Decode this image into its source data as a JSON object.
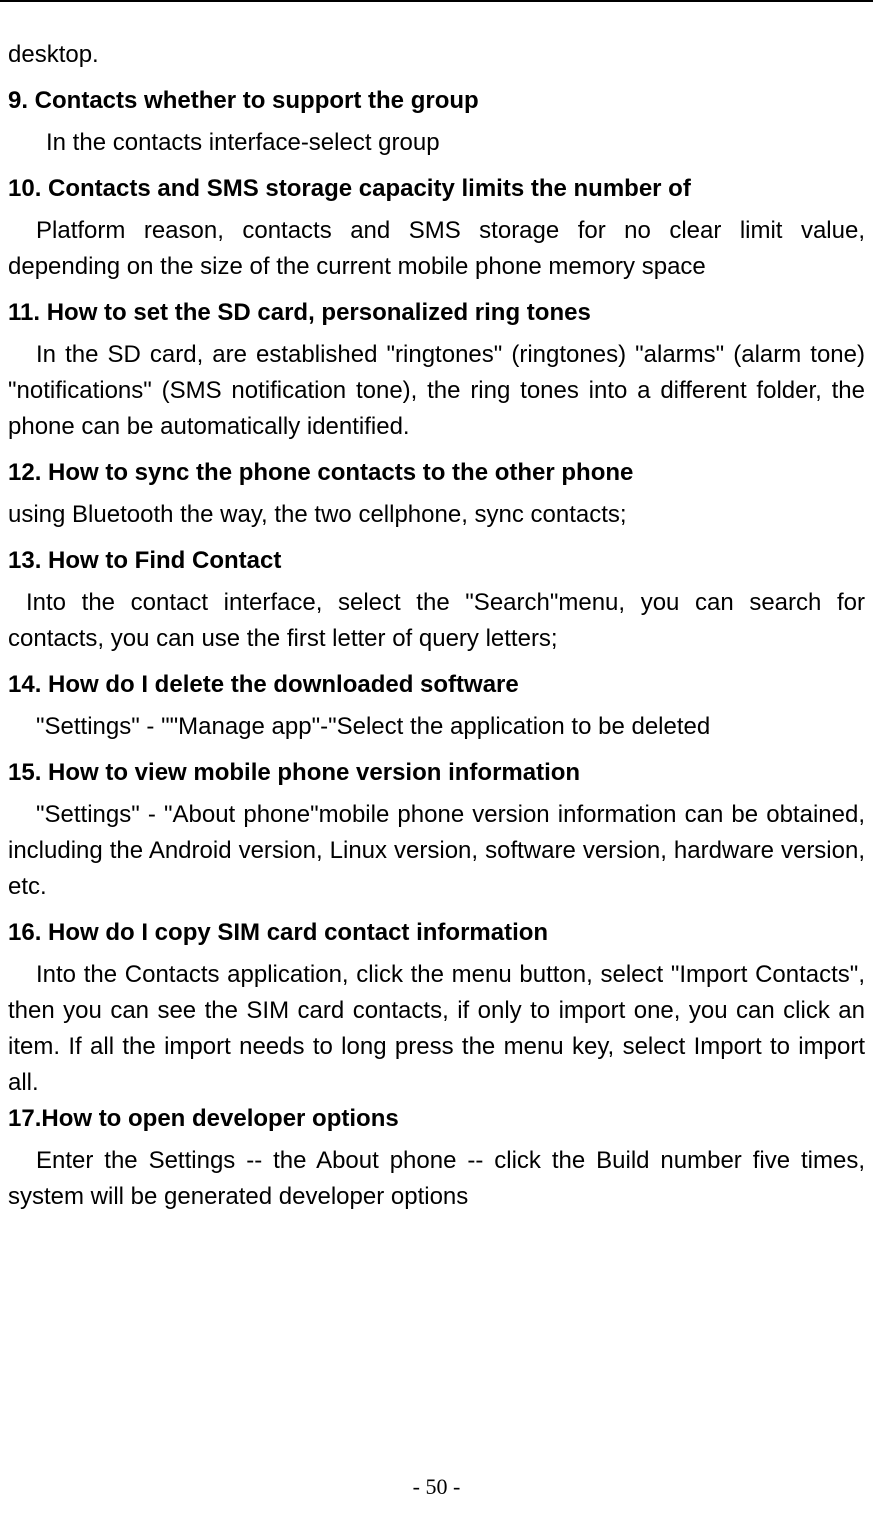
{
  "fragment": "desktop.",
  "sections": [
    {
      "heading": "9. Contacts whether to support the group",
      "body": "In the contacts interface-select group",
      "indent": "indent1"
    },
    {
      "heading": "10. Contacts and SMS storage capacity limits the number of",
      "body": "Platform reason, contacts and SMS storage for no clear limit value, depending on the size of the current mobile phone memory space",
      "indent": "indent2",
      "justify": true
    },
    {
      "heading": "11. How to set the SD card, personalized ring tones",
      "body": "In the SD card, are established \"ringtones\" (ringtones) \"alarms\" (alarm tone) \"notifications\" (SMS notification tone), the ring tones into a different folder, the phone can be automatically identified.",
      "indent": "indent2",
      "justify": true
    },
    {
      "heading": "12. How to sync the phone contacts to the other phone",
      "body": "using Bluetooth the way, the two cellphone, sync contacts;",
      "indent": ""
    },
    {
      "heading": "13. How to Find Contact",
      "body": "Into the contact interface, select the \"Search\"menu, you can search for contacts, you can use the first letter of query letters;",
      "indent": "indent3",
      "justify": true
    },
    {
      "heading": "14. How do I delete the downloaded software",
      "body": "\"Settings\" - \"\"Manage app\"-\"Select the application to be deleted",
      "indent": "indent2"
    },
    {
      "heading": "15. How to view mobile phone version information",
      "body": "\"Settings\" - \"About phone\"mobile phone version information can be obtained, including the Android version, Linux version, software version, hardware version, etc.",
      "indent": "indent2",
      "justify": true
    },
    {
      "heading": "16. How do I copy SIM card contact information",
      "body": "Into the Contacts application, click the menu button, select \"Import Contacts\", then you can see the SIM card contacts, if only to import one, you can click an item. If all the import needs to long press the menu key, select Import to import all.",
      "indent": "indent2",
      "justify": true,
      "tight": true
    },
    {
      "heading": "17.How to open developer options",
      "body": "Enter the Settings -- the About phone -- click the Build number five times, system will be generated developer options",
      "indent": "indent2",
      "justify": true,
      "tightTop": true
    }
  ],
  "pageNumber": "- 50 -"
}
